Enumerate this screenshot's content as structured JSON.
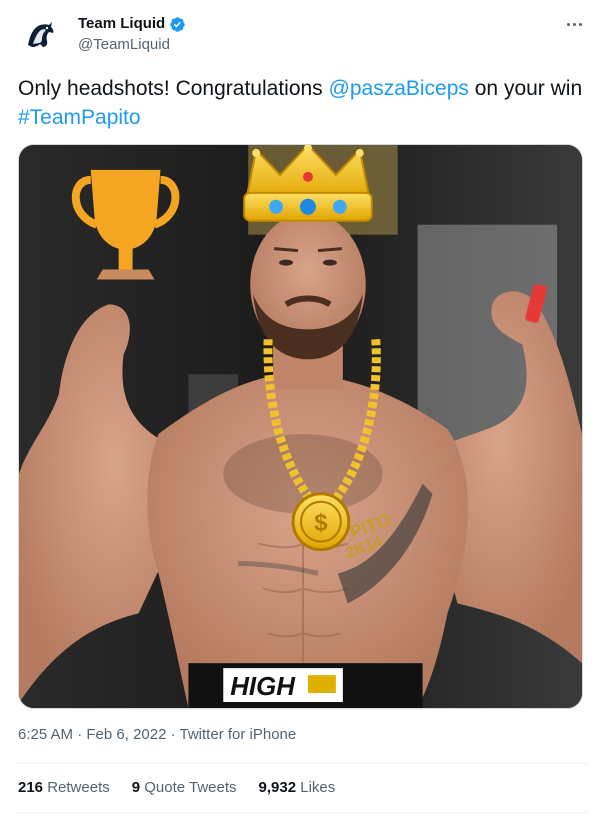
{
  "author": {
    "display_name": "Team Liquid",
    "handle": "@TeamLiquid",
    "verified": true,
    "avatar_icon": "horse-logo-icon"
  },
  "tweet": {
    "text_prefix": "Only headshots! Congratulations ",
    "mention": "@paszaBiceps",
    "text_middle": " on your win ",
    "hashtag": "#TeamPapito"
  },
  "media": {
    "description_icons": [
      "trophy-icon",
      "crown-icon",
      "gold-chain-icon",
      "dollar-medallion-icon"
    ],
    "shorts_brand": "HIGH"
  },
  "meta": {
    "time": "6:25 AM",
    "separator": " · ",
    "date": "Feb 6, 2022",
    "source": "Twitter for iPhone"
  },
  "stats": {
    "retweets_value": "216",
    "retweets_label": "Retweets",
    "quotes_value": "9",
    "quotes_label": "Quote Tweets",
    "likes_value": "9,932",
    "likes_label": "Likes"
  },
  "colors": {
    "link": "#1d9bf0",
    "secondary_text": "#536471",
    "verified": "#1d9bf0"
  }
}
